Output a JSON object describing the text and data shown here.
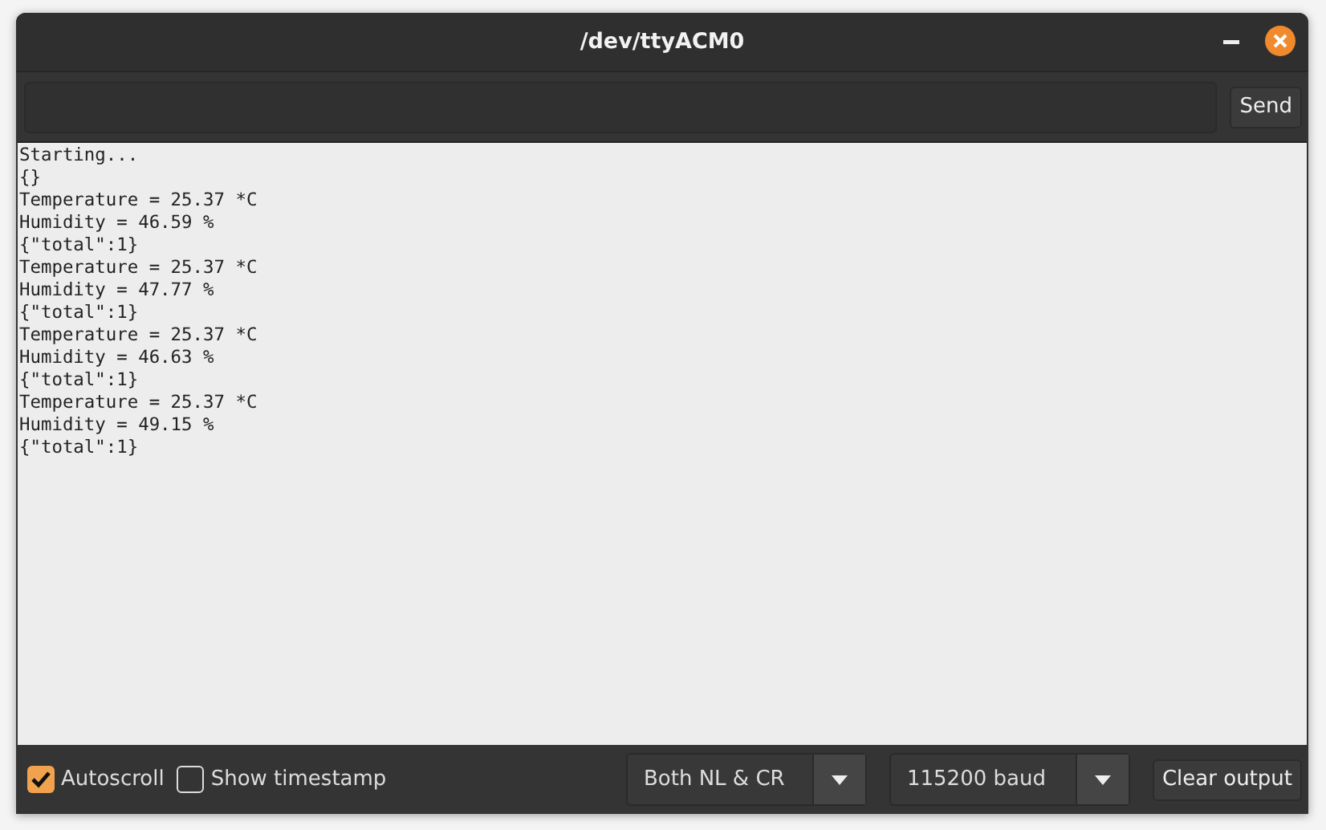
{
  "window": {
    "title": "/dev/ttyACM0"
  },
  "input": {
    "send_label": "Send"
  },
  "output_lines": [
    "Starting...",
    "{}",
    "Temperature = 25.37 *C",
    "Humidity = 46.59 %",
    "{\"total\":1}",
    "Temperature = 25.37 *C",
    "Humidity = 47.77 %",
    "{\"total\":1}",
    "Temperature = 25.37 *C",
    "Humidity = 46.63 %",
    "{\"total\":1}",
    "Temperature = 25.37 *C",
    "Humidity = 49.15 %",
    "{\"total\":1}"
  ],
  "options": [
    {
      "label": "Autoscroll",
      "checked": true
    },
    {
      "label": "Show timestamp",
      "checked": false
    }
  ],
  "dropdowns": [
    "Both NL & CR",
    "115200 baud"
  ],
  "clear_button": "Clear output"
}
